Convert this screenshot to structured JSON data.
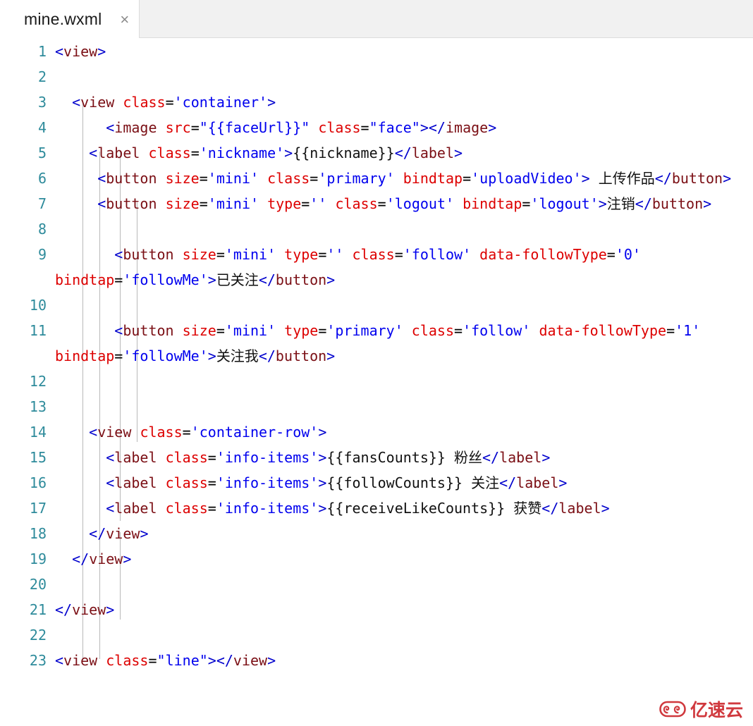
{
  "tab": {
    "title": "mine.wxml",
    "close_label": "×",
    "close_icon": "close-icon"
  },
  "editor": {
    "language": "wxml",
    "colors": {
      "bracket": "#0000cd",
      "tag": "#7b0f15",
      "attribute": "#dd0000",
      "value": "#0000ee",
      "text": "#111111",
      "line_number": "#2e8b9b",
      "background": "#ffffff"
    },
    "line_numbers": [
      "1",
      "2",
      "3",
      "4",
      "5",
      "6",
      "7",
      "8",
      "9",
      "10",
      "11",
      "12",
      "13",
      "14",
      "15",
      "16",
      "17",
      "18",
      "19",
      "20",
      "21",
      "22",
      "23"
    ],
    "lines": [
      {
        "n": "1",
        "text": "<view>"
      },
      {
        "n": "2",
        "text": ""
      },
      {
        "n": "3",
        "text": "  <view class='container'>"
      },
      {
        "n": "4",
        "text": "      <image src=\"{{faceUrl}}\" class=\"face\"></image>"
      },
      {
        "n": "5",
        "text": "    <label class='nickname'>{{nickname}}</label>"
      },
      {
        "n": "6",
        "text": "     <button size='mini' class='primary' bindtap='uploadVideo'> 上传作品</button>"
      },
      {
        "n": "7",
        "text": "     <button size='mini' type='' class='logout' bindtap='logout'>注销</button>"
      },
      {
        "n": "8",
        "text": ""
      },
      {
        "n": "9",
        "text": "       <button size='mini' type='' class='follow' data-followType='0' bindtap='followMe'>已关注</button>"
      },
      {
        "n": "10",
        "text": ""
      },
      {
        "n": "11",
        "text": "       <button size='mini' type='primary' class='follow' data-followType='1' bindtap='followMe'>关注我</button>"
      },
      {
        "n": "12",
        "text": ""
      },
      {
        "n": "13",
        "text": ""
      },
      {
        "n": "14",
        "text": "    <view class='container-row'>"
      },
      {
        "n": "15",
        "text": "      <label class='info-items'>{{fansCounts}} 粉丝</label>"
      },
      {
        "n": "16",
        "text": "      <label class='info-items'>{{followCounts}} 关注</label>"
      },
      {
        "n": "17",
        "text": "      <label class='info-items'>{{receiveLikeCounts}} 获赞</label>"
      },
      {
        "n": "18",
        "text": "    </view>"
      },
      {
        "n": "19",
        "text": "  </view>"
      },
      {
        "n": "20",
        "text": ""
      },
      {
        "n": "21",
        "text": "</view>"
      },
      {
        "n": "22",
        "text": ""
      },
      {
        "n": "23",
        "text": "<view class=\"line\"></view>"
      }
    ]
  },
  "watermark": {
    "text": "亿速云",
    "logo_icon": "cloud-logo-icon",
    "color": "#d0393e"
  }
}
